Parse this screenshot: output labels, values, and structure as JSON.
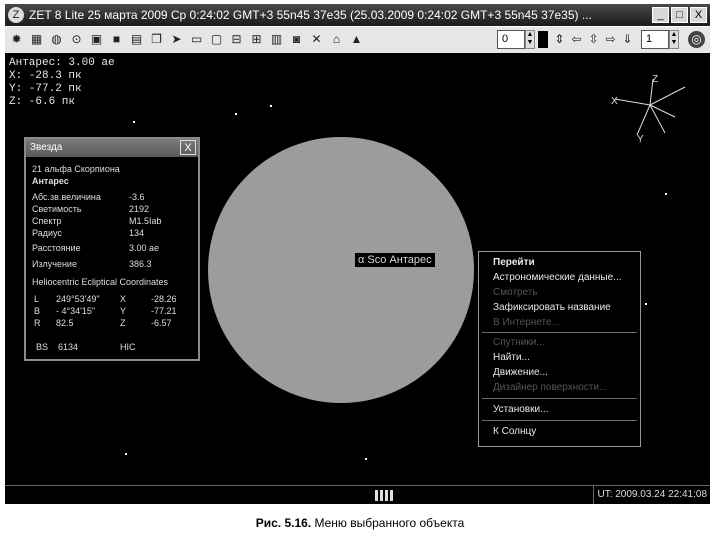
{
  "window": {
    "title": "ZET 8 Lite   25 марта 2009  Ср   0:24:02 GMT+3 55n45  37e35  (25.03.2009   0:24:02 GMT+3 55n45 37e35) ...",
    "minimize": "_",
    "maximize": "□",
    "close": "X"
  },
  "toolbar": {
    "spin1_value": "0",
    "spin2_value": "1"
  },
  "hud": {
    "line1": "Антарес: 3.00 ае",
    "line2": "X: -28.3 пк",
    "line3": "Y: -77.2 пк",
    "line4": "Z: -6.6 пк"
  },
  "star_window": {
    "title": "Звезда",
    "close": "X",
    "name": "21 альфа Скорпиона",
    "proper_name": "Антарес",
    "rows": [
      {
        "label": "Абс.зв.величина",
        "value": "-3.6"
      },
      {
        "label": "Светимость",
        "value": "2192"
      },
      {
        "label": "Спектр",
        "value": "M1.5Iab"
      },
      {
        "label": "Радиус",
        "value": "134"
      },
      {
        "label": "Расстояние",
        "value": "3.00 ае"
      },
      {
        "label": "Излучение",
        "value": "386.3"
      }
    ],
    "coords_header": "Heliocentric Ecliptical Coordinates",
    "coords": [
      {
        "k": "L",
        "v": "249°53'49\"",
        "axis": "X",
        "val": "-28.26"
      },
      {
        "k": "B",
        "v": "- 4°34'15\"",
        "axis": "Y",
        "val": "-77.21"
      },
      {
        "k": "R",
        "v": "82.5",
        "axis": "Z",
        "val": "-6.57"
      }
    ],
    "bs_label": "BS",
    "bs_value": "6134",
    "hic_label": "HIC"
  },
  "object_label": {
    "symbol": "α",
    "text": "Sco Антарес"
  },
  "context_menu": {
    "items": [
      {
        "label": "Перейти",
        "style": "bold"
      },
      {
        "label": "Астрономические данные...",
        "style": "normal"
      },
      {
        "label": "Смотреть",
        "style": "dis"
      },
      {
        "label": "Зафиксировать название",
        "style": "normal"
      },
      {
        "label": "В Интернете...",
        "style": "dis"
      },
      {
        "label": "Спутники...",
        "style": "dis"
      },
      {
        "label": "Найти...",
        "style": "normal"
      },
      {
        "label": "Движение...",
        "style": "normal"
      },
      {
        "label": "Дизайнер поверхности...",
        "style": "dis"
      },
      {
        "label": "Установки...",
        "style": "normal"
      },
      {
        "label": "К Солнцу",
        "style": "normal"
      }
    ]
  },
  "axes": {
    "x": "X",
    "y": "Y",
    "z": "Z"
  },
  "status": {
    "ut": "UT: 2009.03.24 22:41:08"
  },
  "caption": {
    "bold": "Рис. 5.16.",
    "text": " Меню выбранного объекта"
  }
}
